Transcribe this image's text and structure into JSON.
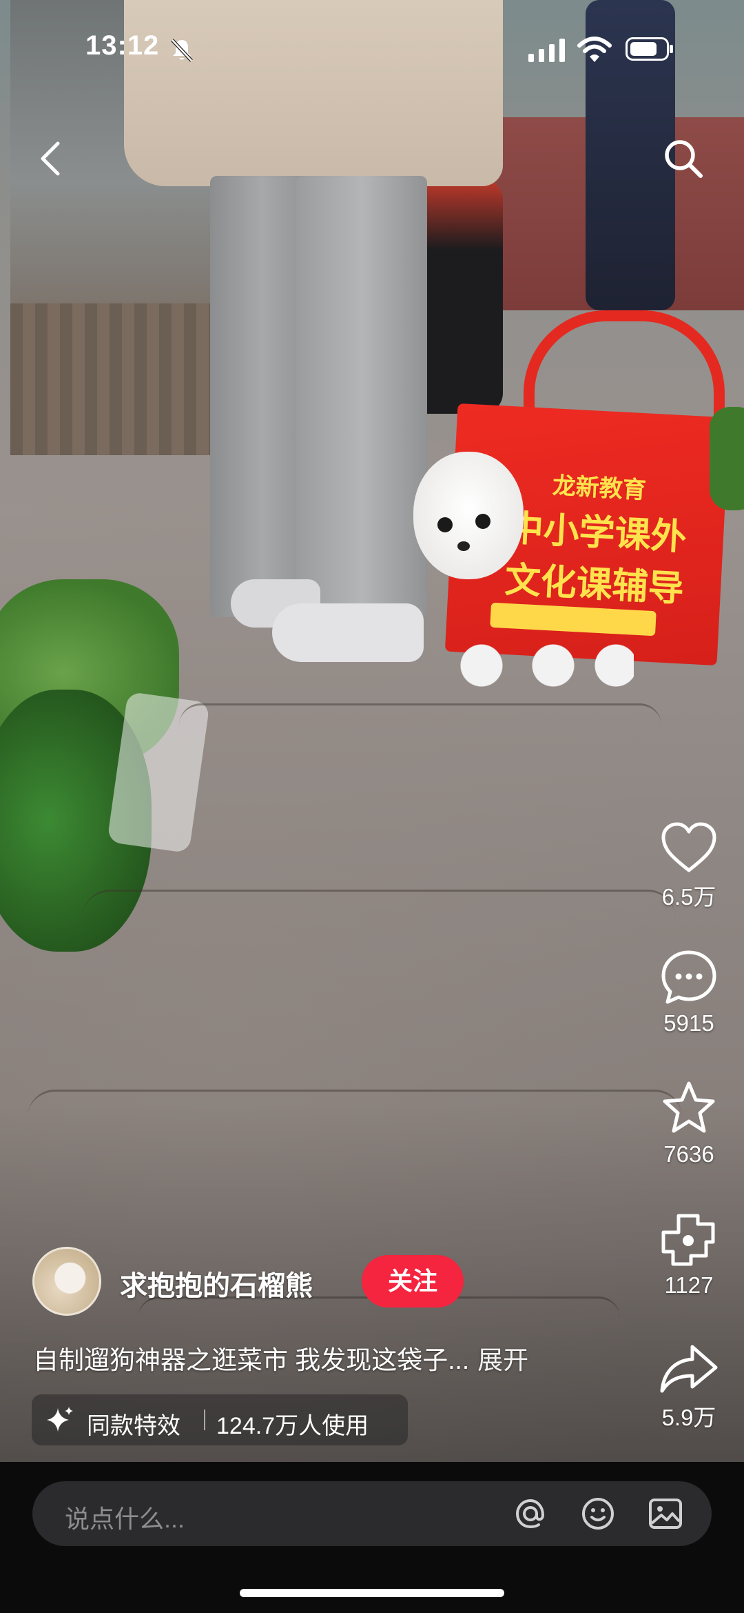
{
  "status_bar": {
    "time": "13:12"
  },
  "author": {
    "name": "求抱抱的石榴熊",
    "follow_label": "关注"
  },
  "caption": {
    "text": "自制遛狗神器之逛菜市 我发现这袋子...",
    "expand_label": "展开"
  },
  "effect": {
    "label": "同款特效",
    "users": "124.7万人使用"
  },
  "actions": {
    "likes": "6.5万",
    "comments": "5915",
    "favorites": "7636",
    "shares_secondary": "1127",
    "shares": "5.9万"
  },
  "comment_input": {
    "placeholder": "说点什么..."
  },
  "video_scene": {
    "bag_brand": "龙新教育",
    "bag_title": "中小学课外",
    "bag_subtitle": "文化课辅导"
  },
  "icons": [
    "back-icon",
    "search-icon",
    "heart-icon",
    "comment-icon",
    "star-icon",
    "share-icon",
    "at-icon",
    "emoji-icon",
    "image-icon",
    "sparkle-icon",
    "bell-mute-icon",
    "signal-icon",
    "wifi-icon",
    "battery-icon"
  ],
  "colors": {
    "follow_button": "#f5243f",
    "bottom_bar": "#0b0b0b",
    "input_bg": "#2b2b2d"
  }
}
